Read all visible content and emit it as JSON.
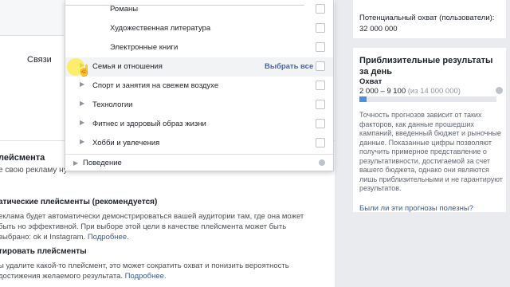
{
  "left": {
    "connections_label": "Связи",
    "section_title": "лейсмента",
    "section_sub": "е свою рекламу ну",
    "auto_title": "атические плейсменты (рекомендуется)",
    "auto_text": "еклама будет автоматически демонстрироваться вашей аудитории там, где она может быть но эффективной. При выборе этой цели в качестве плейсмента может быть выбрано: ok и Instagram.",
    "auto_link": "Подробнее.",
    "edit_title": "тировать плейсменты",
    "edit_text": "ы удалите какой-то плейсмент, это может сократить охват и понизить вероятность достижения желаемого результата.",
    "edit_link": "Подробнее."
  },
  "dropdown": {
    "rows": [
      {
        "label": "Романы",
        "indent": "child"
      },
      {
        "label": "Художественная литература",
        "indent": "child"
      },
      {
        "label": "Электронные книги",
        "indent": "child"
      },
      {
        "label": "Семья и отношения",
        "indent": "parent",
        "hover": true
      },
      {
        "label": "Спорт и занятия на свежем воздухе",
        "indent": "parent"
      },
      {
        "label": "Технологии",
        "indent": "parent"
      },
      {
        "label": "Фитнес и здоровый образ жизни",
        "indent": "parent"
      },
      {
        "label": "Хобби и увлечения",
        "indent": "parent"
      }
    ],
    "select_all": "Выбрать все",
    "footer": "Поведение"
  },
  "right": {
    "potential_label": "Потенциальный охват (пользователи):",
    "potential_value": "32 000 000",
    "results_title": "Приблизительные результаты за день",
    "reach_label": "Охват",
    "reach_range": "2 000 – 9 100",
    "reach_total": "(из 14 000 000)",
    "reach_fraction": 0.05,
    "accuracy_text": "Точность прогнозов зависит от таких факторов, как данные прошедших кампаний, введенный бюджет и рыночные данные. Показанные цифры позволяют получить примерное представление о результативности, достигаемой за счет вашего бюджета, однако они являются лишь приблизительными и не гарантируют результатов.",
    "forecast_link": "Были ли эти прогнозы полезны?"
  }
}
